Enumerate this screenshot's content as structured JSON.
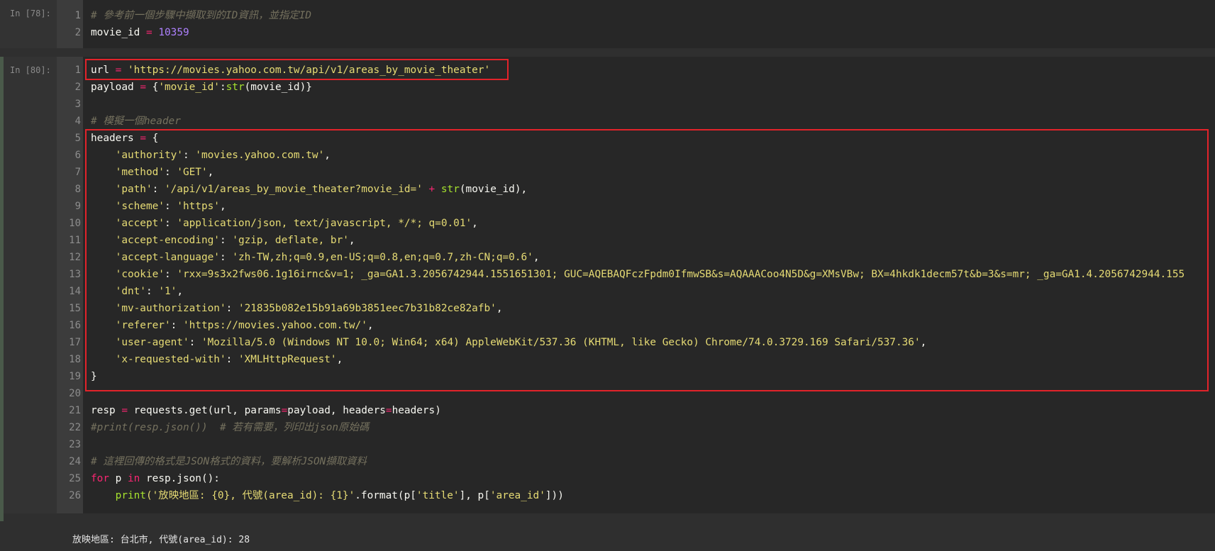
{
  "cells": [
    {
      "prompt": "In [78]:",
      "lines": [
        {
          "n": "1",
          "segs": [
            {
              "t": "# 參考前一個步驟中擷取到的ID資訊，並指定ID",
              "c": "cm"
            }
          ]
        },
        {
          "n": "2",
          "segs": [
            {
              "t": "movie_id ",
              "c": "var"
            },
            {
              "t": "=",
              "c": "kw"
            },
            {
              "t": " ",
              "c": "op"
            },
            {
              "t": "10359",
              "c": "num"
            }
          ]
        }
      ]
    },
    {
      "prompt": "In [80]:",
      "lines": [
        {
          "n": "1",
          "segs": [
            {
              "t": "url ",
              "c": "var"
            },
            {
              "t": "=",
              "c": "kw"
            },
            {
              "t": " 'https://movies.yahoo.com.tw/api/v1/areas_by_movie_theater'",
              "c": "str"
            }
          ]
        },
        {
          "n": "2",
          "segs": [
            {
              "t": "payload ",
              "c": "var"
            },
            {
              "t": "=",
              "c": "kw"
            },
            {
              "t": " {",
              "c": "op"
            },
            {
              "t": "'movie_id'",
              "c": "str"
            },
            {
              "t": ":",
              "c": "op"
            },
            {
              "t": "str",
              "c": "fn"
            },
            {
              "t": "(movie_id)}",
              "c": "op"
            }
          ]
        },
        {
          "n": "3",
          "segs": []
        },
        {
          "n": "4",
          "segs": [
            {
              "t": "# 模擬一個header",
              "c": "cm"
            }
          ]
        },
        {
          "n": "5",
          "segs": [
            {
              "t": "headers ",
              "c": "var"
            },
            {
              "t": "=",
              "c": "kw"
            },
            {
              "t": " {",
              "c": "op"
            }
          ]
        },
        {
          "n": "6",
          "segs": [
            {
              "t": "    'authority'",
              "c": "str"
            },
            {
              "t": ": ",
              "c": "op"
            },
            {
              "t": "'movies.yahoo.com.tw'",
              "c": "str"
            },
            {
              "t": ",",
              "c": "op"
            }
          ]
        },
        {
          "n": "7",
          "segs": [
            {
              "t": "    'method'",
              "c": "str"
            },
            {
              "t": ": ",
              "c": "op"
            },
            {
              "t": "'GET'",
              "c": "str"
            },
            {
              "t": ",",
              "c": "op"
            }
          ]
        },
        {
          "n": "8",
          "segs": [
            {
              "t": "    'path'",
              "c": "str"
            },
            {
              "t": ": ",
              "c": "op"
            },
            {
              "t": "'/api/v1/areas_by_movie_theater?movie_id='",
              "c": "str"
            },
            {
              "t": " ",
              "c": "op"
            },
            {
              "t": "+",
              "c": "kw"
            },
            {
              "t": " ",
              "c": "op"
            },
            {
              "t": "str",
              "c": "fn"
            },
            {
              "t": "(movie_id),",
              "c": "op"
            }
          ]
        },
        {
          "n": "9",
          "segs": [
            {
              "t": "    'scheme'",
              "c": "str"
            },
            {
              "t": ": ",
              "c": "op"
            },
            {
              "t": "'https'",
              "c": "str"
            },
            {
              "t": ",",
              "c": "op"
            }
          ]
        },
        {
          "n": "10",
          "segs": [
            {
              "t": "    'accept'",
              "c": "str"
            },
            {
              "t": ": ",
              "c": "op"
            },
            {
              "t": "'application/json, text/javascript, */*; q=0.01'",
              "c": "str"
            },
            {
              "t": ",",
              "c": "op"
            }
          ]
        },
        {
          "n": "11",
          "segs": [
            {
              "t": "    'accept-encoding'",
              "c": "str"
            },
            {
              "t": ": ",
              "c": "op"
            },
            {
              "t": "'gzip, deflate, br'",
              "c": "str"
            },
            {
              "t": ",",
              "c": "op"
            }
          ]
        },
        {
          "n": "12",
          "segs": [
            {
              "t": "    'accept-language'",
              "c": "str"
            },
            {
              "t": ": ",
              "c": "op"
            },
            {
              "t": "'zh-TW,zh;q=0.9,en-US;q=0.8,en;q=0.7,zh-CN;q=0.6'",
              "c": "str"
            },
            {
              "t": ",",
              "c": "op"
            }
          ]
        },
        {
          "n": "13",
          "segs": [
            {
              "t": "    'cookie'",
              "c": "str"
            },
            {
              "t": ": ",
              "c": "op"
            },
            {
              "t": "'rxx=9s3x2fws06.1g16irnc&v=1; _ga=GA1.3.2056742944.1551651301; GUC=AQEBAQFczFpdm0IfmwSB&s=AQAAACoo4N5D&g=XMsVBw; BX=4hkdk1decm57t&b=3&s=mr; _ga=GA1.4.2056742944.155",
              "c": "str"
            }
          ]
        },
        {
          "n": "14",
          "segs": [
            {
              "t": "    'dnt'",
              "c": "str"
            },
            {
              "t": ": ",
              "c": "op"
            },
            {
              "t": "'1'",
              "c": "str"
            },
            {
              "t": ",",
              "c": "op"
            }
          ]
        },
        {
          "n": "15",
          "segs": [
            {
              "t": "    'mv-authorization'",
              "c": "str"
            },
            {
              "t": ": ",
              "c": "op"
            },
            {
              "t": "'21835b082e15b91a69b3851eec7b31b82ce82afb'",
              "c": "str"
            },
            {
              "t": ",",
              "c": "op"
            }
          ]
        },
        {
          "n": "16",
          "segs": [
            {
              "t": "    'referer'",
              "c": "str"
            },
            {
              "t": ": ",
              "c": "op"
            },
            {
              "t": "'https://movies.yahoo.com.tw/'",
              "c": "str"
            },
            {
              "t": ",",
              "c": "op"
            }
          ]
        },
        {
          "n": "17",
          "segs": [
            {
              "t": "    'user-agent'",
              "c": "str"
            },
            {
              "t": ": ",
              "c": "op"
            },
            {
              "t": "'Mozilla/5.0 (Windows NT 10.0; Win64; x64) AppleWebKit/537.36 (KHTML, like Gecko) Chrome/74.0.3729.169 Safari/537.36'",
              "c": "str"
            },
            {
              "t": ",",
              "c": "op"
            }
          ]
        },
        {
          "n": "18",
          "segs": [
            {
              "t": "    'x-requested-with'",
              "c": "str"
            },
            {
              "t": ": ",
              "c": "op"
            },
            {
              "t": "'XMLHttpRequest'",
              "c": "str"
            },
            {
              "t": ",",
              "c": "op"
            }
          ]
        },
        {
          "n": "19",
          "segs": [
            {
              "t": "}",
              "c": "op"
            }
          ]
        },
        {
          "n": "20",
          "segs": []
        },
        {
          "n": "21",
          "segs": [
            {
              "t": "resp ",
              "c": "var"
            },
            {
              "t": "=",
              "c": "kw"
            },
            {
              "t": " requests.get(url, params",
              "c": "op"
            },
            {
              "t": "=",
              "c": "kw"
            },
            {
              "t": "payload, headers",
              "c": "op"
            },
            {
              "t": "=",
              "c": "kw"
            },
            {
              "t": "headers)",
              "c": "op"
            }
          ]
        },
        {
          "n": "22",
          "segs": [
            {
              "t": "#print(resp.json())  # 若有需要，列印出json原始碼",
              "c": "cm"
            }
          ]
        },
        {
          "n": "23",
          "segs": []
        },
        {
          "n": "24",
          "segs": [
            {
              "t": "# 這裡回傳的格式是JSON格式的資料，要解析JSON擷取資料",
              "c": "cm"
            }
          ]
        },
        {
          "n": "25",
          "segs": [
            {
              "t": "for",
              "c": "kw"
            },
            {
              "t": " p ",
              "c": "op"
            },
            {
              "t": "in",
              "c": "kw"
            },
            {
              "t": " resp.json():",
              "c": "op"
            }
          ]
        },
        {
          "n": "26",
          "segs": [
            {
              "t": "    ",
              "c": "op"
            },
            {
              "t": "print",
              "c": "fn"
            },
            {
              "t": "('放映地區: {0}, 代號(area_id): {1}'",
              "c": "str"
            },
            {
              "t": ".format(p[",
              "c": "op"
            },
            {
              "t": "'title'",
              "c": "str"
            },
            {
              "t": "], p[",
              "c": "op"
            },
            {
              "t": "'area_id'",
              "c": "str"
            },
            {
              "t": "]))",
              "c": "op"
            }
          ]
        }
      ]
    }
  ],
  "output_text": "放映地區: 台北市, 代號(area_id): 28"
}
